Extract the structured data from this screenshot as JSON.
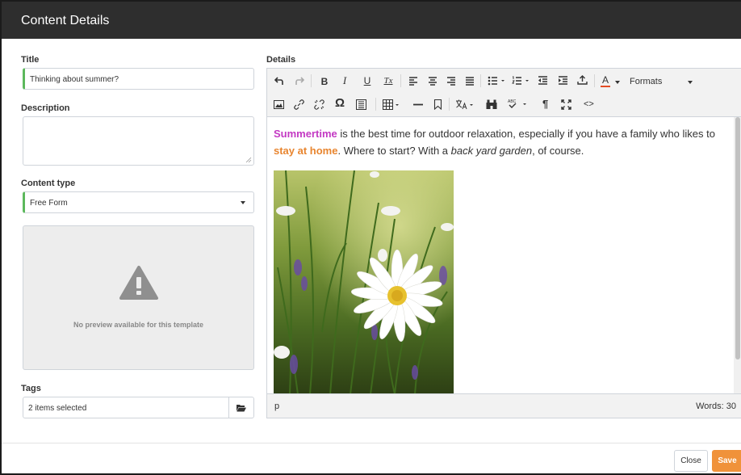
{
  "dialog": {
    "title": "Content Details"
  },
  "left": {
    "title_label": "Title",
    "title_value": "Thinking about summer?",
    "description_label": "Description",
    "description_value": "",
    "content_type_label": "Content type",
    "content_type_value": "Free Form",
    "preview_text": "No preview available for this template",
    "tags_label": "Tags",
    "tags_value": "2 items selected"
  },
  "details": {
    "label": "Details",
    "toolbar": {
      "bold": "B",
      "italic": "I",
      "underline": "U",
      "clear_format": "Tx",
      "font_color": "A",
      "formats": "Formats",
      "omega": "Ω",
      "pilcrow": "¶",
      "code": "<>"
    },
    "content": {
      "text_1": "Summertime",
      "text_2": " is the best time for outdoor relaxation, especially if you have a family who likes to ",
      "text_3": "stay at home",
      "text_4": ". Where to start? With a ",
      "text_5": "back yard garden",
      "text_6": ", of course."
    },
    "status_path": "p",
    "word_count": "Words: 30"
  },
  "footer": {
    "close_label": "Close",
    "save_label": "Save"
  },
  "colors": {
    "header": "#2e2e2e",
    "accent_save": "#f0923a",
    "valid_border": "#5cb85c",
    "pink": "#c339c3",
    "orange": "#e8852f"
  }
}
